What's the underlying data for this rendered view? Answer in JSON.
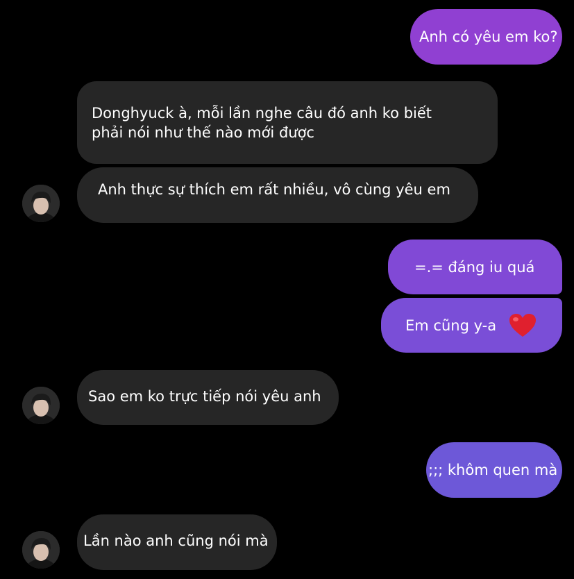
{
  "chat": {
    "messages": [
      {
        "sender": "me",
        "text": "Anh có yêu em ko?"
      },
      {
        "sender": "other",
        "lines": [
          "Donghyuck à, mỗi lần nghe câu đó anh ko biết",
          "phải nói như thế nào mới được"
        ]
      },
      {
        "sender": "other",
        "text": "Anh thực sự thích em rất nhiều, vô cùng yêu em"
      },
      {
        "sender": "me",
        "text": "=.= đáng iu quá"
      },
      {
        "sender": "me",
        "text": "Em cũng  y-a",
        "emoji": "heart-emoji"
      },
      {
        "sender": "other",
        "text": "Sao em ko trực tiếp nói yêu anh"
      },
      {
        "sender": "me",
        "text": ";;; khôm quen mà"
      },
      {
        "sender": "other",
        "text": "Lần nào anh cũng nói mà"
      }
    ]
  },
  "colors": {
    "background": "#000000",
    "incoming_bubble": "#262626",
    "outgoing_gradient_start": "#8f3fd4",
    "outgoing_gradient_end": "#6a55d9",
    "text": "#ffffff",
    "heart": "#e0202e"
  }
}
